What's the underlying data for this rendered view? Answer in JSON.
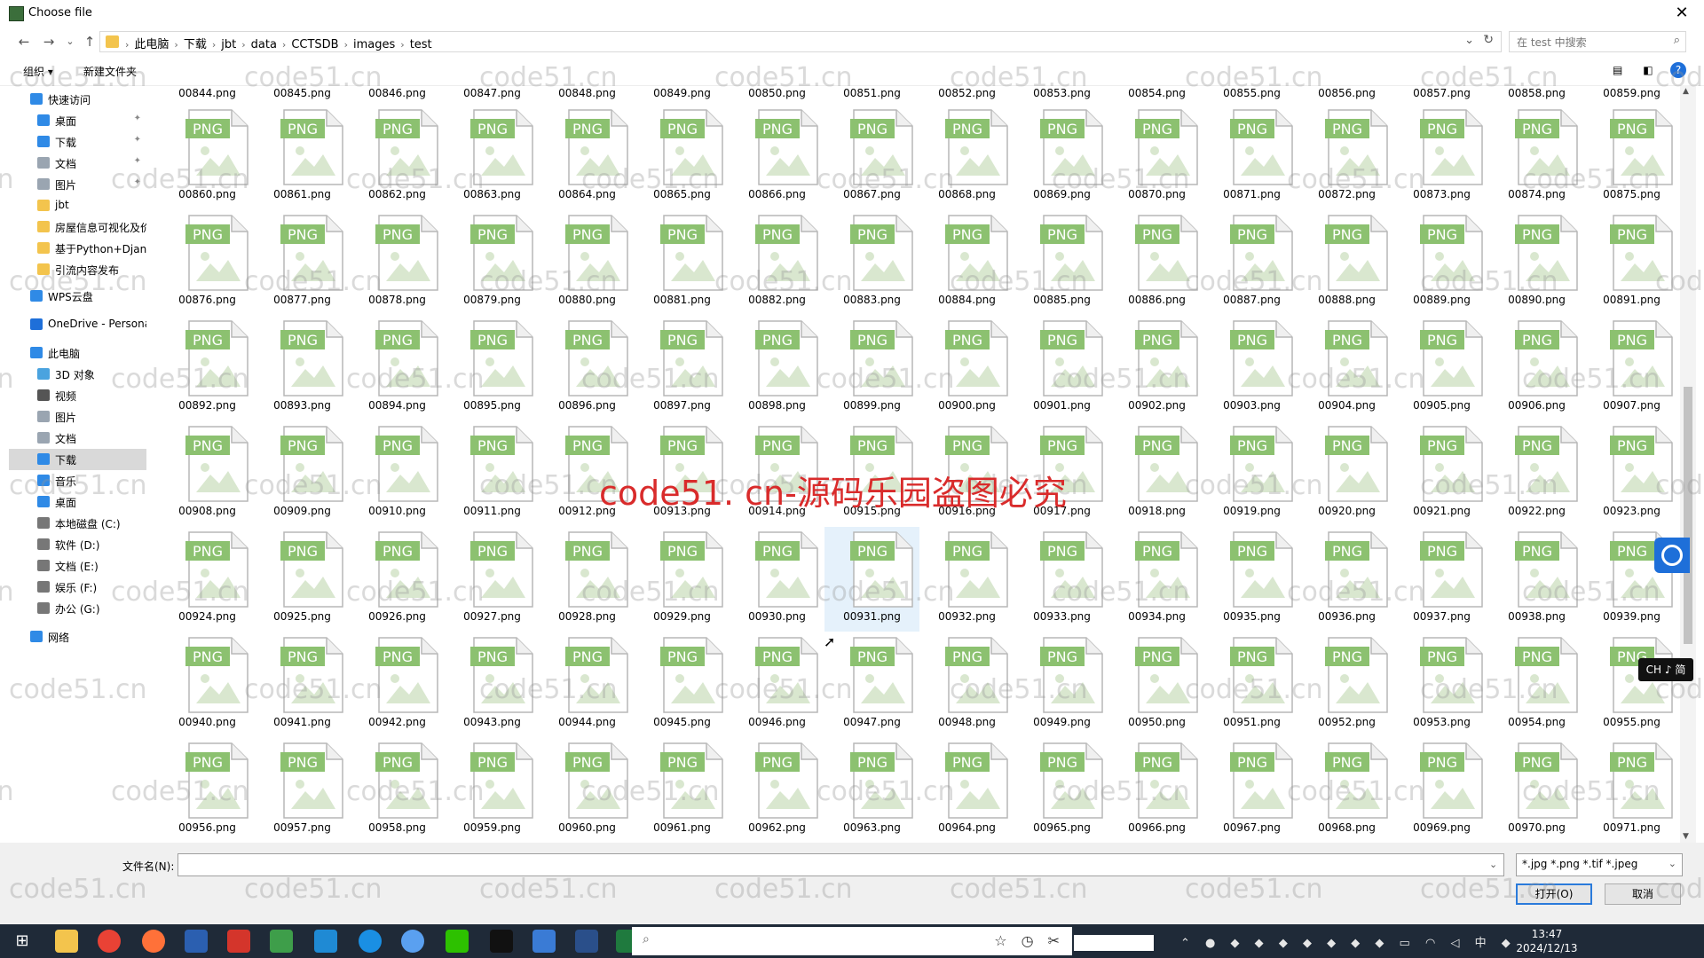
{
  "window": {
    "title": "Choose file",
    "close_glyph": "✕"
  },
  "nav": {
    "back": "←",
    "forward": "→",
    "dropdown": "⌄",
    "up": "↑",
    "breadcrumb": [
      "此电脑",
      "下载",
      "jbt",
      "data",
      "CCTSDB",
      "images",
      "test"
    ],
    "search_placeholder": "在 test 中搜索"
  },
  "toolbar": {
    "organize": "组织 ▾",
    "new_folder": "新建文件夹"
  },
  "sidebar": [
    {
      "label": "快速访问",
      "icon": "star-icon",
      "color": "#2f8ae6",
      "indent": 1,
      "pin": false
    },
    {
      "label": "桌面",
      "icon": "desktop-icon",
      "color": "#2f8ae6",
      "indent": 2,
      "pin": true
    },
    {
      "label": "下载",
      "icon": "download-icon",
      "color": "#2f8ae6",
      "indent": 2,
      "pin": true
    },
    {
      "label": "文档",
      "icon": "document-icon",
      "color": "#9aa5b1",
      "indent": 2,
      "pin": true
    },
    {
      "label": "图片",
      "icon": "pictures-icon",
      "color": "#9aa5b1",
      "indent": 2,
      "pin": true
    },
    {
      "label": "jbt",
      "icon": "folder-icon",
      "color": "#f3c44d",
      "indent": 2,
      "pin": false
    },
    {
      "label": "房屋信息可视化及价",
      "icon": "folder-icon",
      "color": "#f3c44d",
      "indent": 2,
      "pin": false
    },
    {
      "label": "基于Python+Django",
      "icon": "folder-icon",
      "color": "#f3c44d",
      "indent": 2,
      "pin": false
    },
    {
      "label": "引流内容发布",
      "icon": "folder-icon",
      "color": "#f3c44d",
      "indent": 2,
      "pin": false
    },
    {
      "label": "WPS云盘",
      "icon": "cloud-icon",
      "color": "#2f8ae6",
      "indent": 1,
      "pin": false
    },
    {
      "label": "OneDrive - Persona",
      "icon": "cloud-icon",
      "color": "#1e6fd9",
      "indent": 1,
      "pin": false
    },
    {
      "label": "此电脑",
      "icon": "computer-icon",
      "color": "#2f8ae6",
      "indent": 1,
      "pin": false
    },
    {
      "label": "3D 对象",
      "icon": "cube-icon",
      "color": "#4aa3df",
      "indent": 2,
      "pin": false
    },
    {
      "label": "视频",
      "icon": "video-icon",
      "color": "#555555",
      "indent": 2,
      "pin": false
    },
    {
      "label": "图片",
      "icon": "pictures-icon",
      "color": "#9aa5b1",
      "indent": 2,
      "pin": false
    },
    {
      "label": "文档",
      "icon": "document-icon",
      "color": "#9aa5b1",
      "indent": 2,
      "pin": false
    },
    {
      "label": "下载",
      "icon": "download-icon",
      "color": "#2f8ae6",
      "indent": 2,
      "pin": false,
      "selected": true
    },
    {
      "label": "音乐",
      "icon": "music-icon",
      "color": "#2f8ae6",
      "indent": 2,
      "pin": false
    },
    {
      "label": "桌面",
      "icon": "desktop-icon",
      "color": "#2f8ae6",
      "indent": 2,
      "pin": false
    },
    {
      "label": "本地磁盘 (C:)",
      "icon": "drive-icon",
      "color": "#777777",
      "indent": 2,
      "pin": false
    },
    {
      "label": "软件 (D:)",
      "icon": "drive-icon",
      "color": "#777777",
      "indent": 2,
      "pin": false
    },
    {
      "label": "文档 (E:)",
      "icon": "drive-icon",
      "color": "#777777",
      "indent": 2,
      "pin": false
    },
    {
      "label": "娱乐 (F:)",
      "icon": "drive-icon",
      "color": "#777777",
      "indent": 2,
      "pin": false
    },
    {
      "label": "办公 (G:)",
      "icon": "drive-icon",
      "color": "#777777",
      "indent": 2,
      "pin": false
    },
    {
      "label": "网络",
      "icon": "network-icon",
      "color": "#2f8ae6",
      "indent": 1,
      "pin": false
    }
  ],
  "files": {
    "icon_badge": "PNG",
    "extension": ".png",
    "top_partial_labels": [
      "00844.png",
      "00845.png",
      "00846.png",
      "00847.png",
      "00848.png",
      "00849.png",
      "00850.png",
      "00851.png",
      "00852.png",
      "00853.png",
      "00854.png",
      "00855.png",
      "00856.png",
      "00857.png",
      "00858.png",
      "00859.png"
    ],
    "first_number": 860,
    "last_number": 971,
    "highlighted": "00931.png"
  },
  "bottom": {
    "filename_label": "文件名(N):",
    "filename_value": "",
    "filter": "*.jpg *.png *.tif *.jpeg",
    "open_button": "打开(O)",
    "cancel_button": "取消"
  },
  "watermark": {
    "tile_text": "code51.cn",
    "center_text": "code51. cn-源码乐园盗图必究"
  },
  "ime": "CH ♪ 简",
  "taskbar": {
    "time": "13:47",
    "date": "2024/12/13"
  }
}
